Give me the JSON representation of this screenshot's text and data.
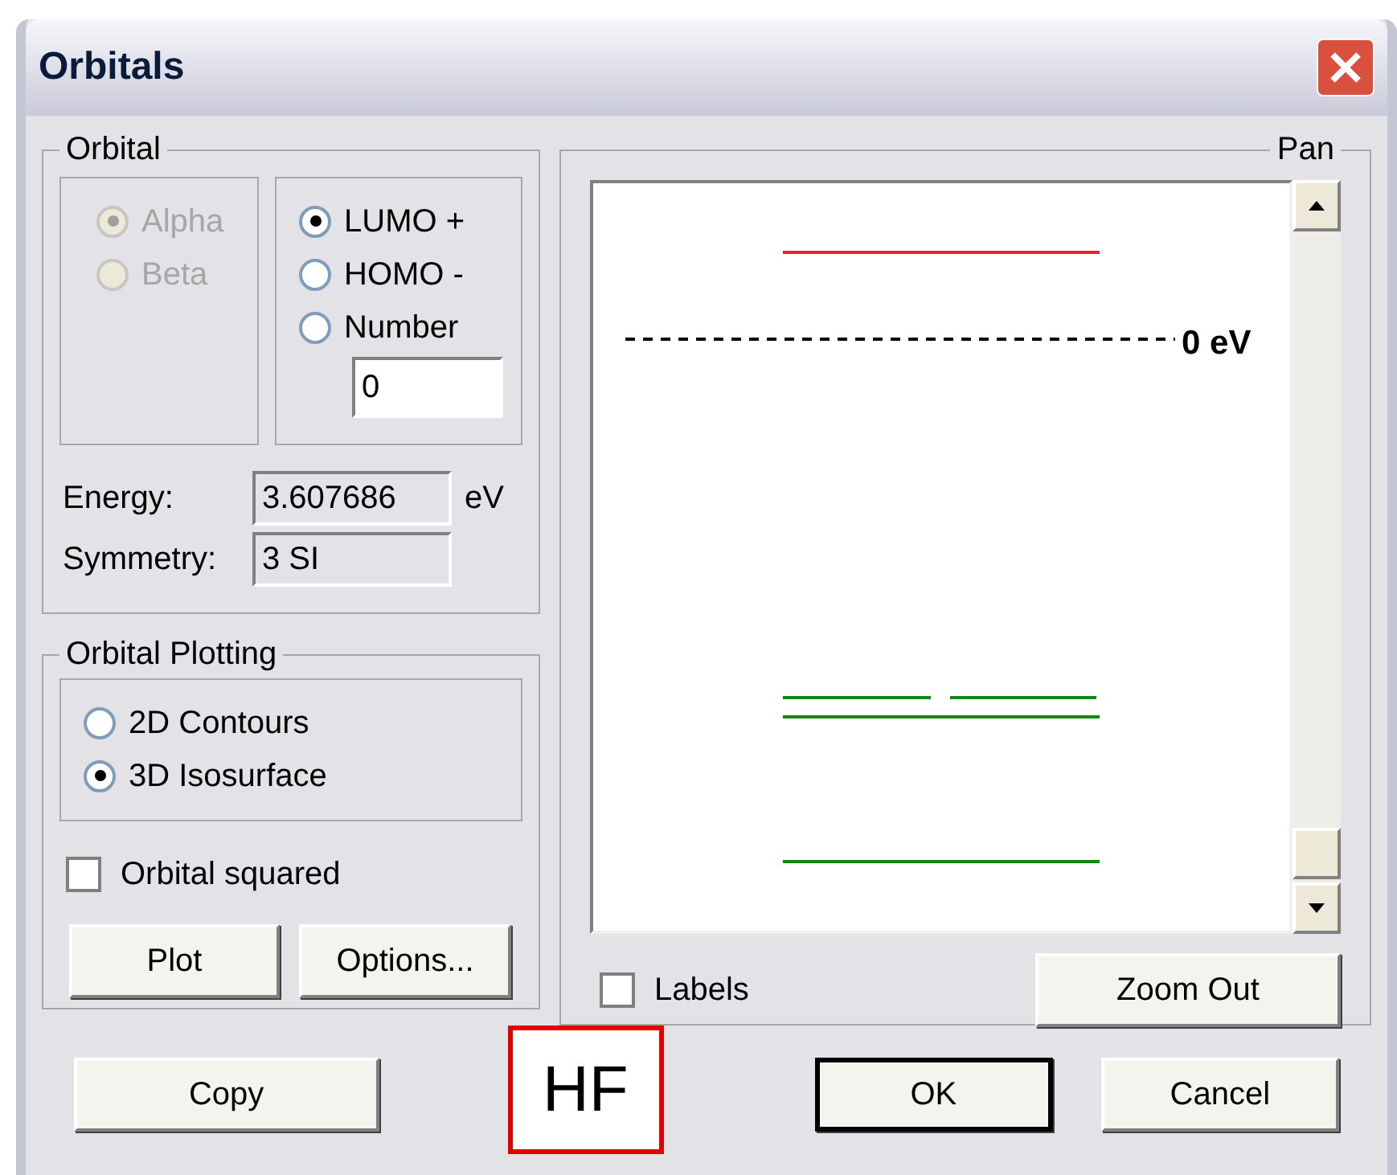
{
  "window": {
    "title": "Orbitals"
  },
  "orbital_group": {
    "title": "Orbital",
    "spin_options": [
      {
        "label": "Alpha",
        "selected": true,
        "disabled": true
      },
      {
        "label": "Beta",
        "selected": false,
        "disabled": true
      }
    ],
    "orbital_options": [
      {
        "label": "LUMO +",
        "selected": true
      },
      {
        "label": "HOMO -",
        "selected": false
      },
      {
        "label": "Number",
        "selected": false
      }
    ],
    "number_field": {
      "value": "0"
    },
    "energy": {
      "label": "Energy:",
      "value": "3.607686",
      "unit": "eV"
    },
    "symmetry": {
      "label": "Symmetry:",
      "value": "3 SI"
    }
  },
  "plotting_group": {
    "title": "Orbital Plotting",
    "options": [
      {
        "label": "2D Contours",
        "selected": false
      },
      {
        "label": "3D Isosurface",
        "selected": true
      }
    ],
    "orbital_squared": {
      "label": "Orbital squared",
      "checked": false
    },
    "buttons": [
      "Plot",
      "Options..."
    ]
  },
  "pan_group": {
    "title": "Pan",
    "zero_label": "0 eV",
    "labels_checkbox": {
      "label": "Labels",
      "checked": false
    },
    "zoom_out_button": "Zoom Out"
  },
  "buttons": [
    {
      "label": "Copy",
      "default": false
    },
    {
      "label": "OK",
      "default": true
    },
    {
      "label": "Cancel",
      "default": false
    }
  ],
  "annotation": "HF"
}
